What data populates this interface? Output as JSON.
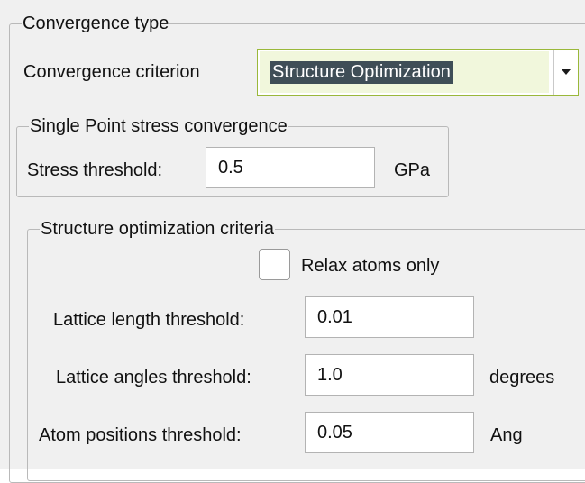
{
  "convergence_type": {
    "legend": "Convergence type",
    "criterion_label": "Convergence criterion",
    "criterion_value": "Structure Optimization"
  },
  "stress_group": {
    "legend": "Single Point stress convergence",
    "threshold_label": "Stress threshold:",
    "threshold_value": "0.5",
    "threshold_unit": "GPa"
  },
  "optimization_group": {
    "legend": "Structure optimization criteria",
    "relax_atoms_label": "Relax atoms only",
    "relax_atoms_checked": false,
    "lattice_length_label": "Lattice length threshold:",
    "lattice_length_value": "0.01",
    "lattice_length_unit": "",
    "lattice_angles_label": "Lattice angles threshold:",
    "lattice_angles_value": "1.0",
    "lattice_angles_unit": "degrees",
    "atom_positions_label": "Atom positions threshold:",
    "atom_positions_value": "0.05",
    "atom_positions_unit": "Ang"
  },
  "colors": {
    "panel_background": "#f0f0f0",
    "combo_focus_border": "#9ab83a",
    "combo_focus_fill": "#f1f7dc",
    "selection_highlight": "#3f4e57"
  }
}
